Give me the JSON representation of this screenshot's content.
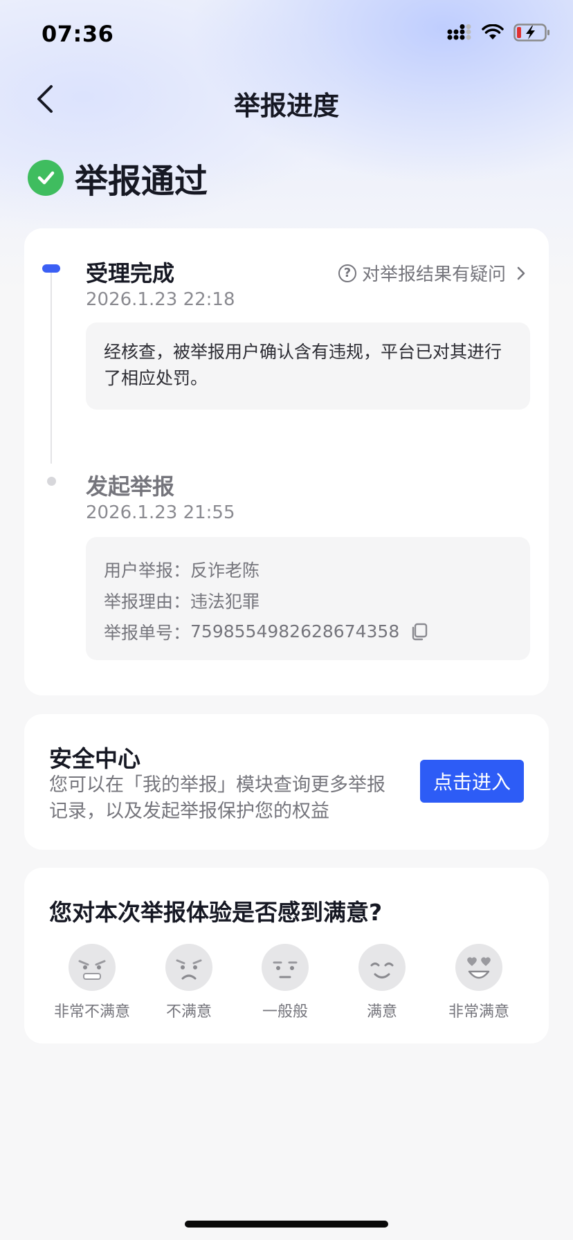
{
  "status_bar": {
    "time": "07:36",
    "icons": [
      "cellular-signal-icon",
      "wifi-icon",
      "battery-charging-icon"
    ]
  },
  "nav": {
    "title": "举报进度",
    "back_icon": "chevron-left-icon"
  },
  "result": {
    "icon": "check-circle-icon",
    "status": "举报通过",
    "color": "#3fbd5f"
  },
  "timeline": {
    "doubt_link": "对举报结果有疑问",
    "steps": [
      {
        "title": "受理完成",
        "time": "2026.1.23 22:18",
        "content": "经核查，被举报用户确认含有违规，平台已对其进行了相应处罚。"
      },
      {
        "title": "发起举报",
        "time": "2026.1.23 21:55",
        "details": [
          {
            "label": "用户举报：",
            "value": "反诈老陈"
          },
          {
            "label": "举报理由：",
            "value": "违法犯罪"
          },
          {
            "label": "举报单号：",
            "value": "7598554982628674358"
          }
        ]
      }
    ]
  },
  "security_center": {
    "title": "安全中心",
    "description": "您可以在「我的举报」模块查询更多举报记录，以及发起举报保护您的权益",
    "button": "点击进入",
    "accent": "#2d5cf6"
  },
  "satisfaction": {
    "question": "您对本次举报体验是否感到满意?",
    "options": [
      {
        "label": "非常不满意",
        "icon": "very-angry-face-icon"
      },
      {
        "label": "不满意",
        "icon": "frown-face-icon"
      },
      {
        "label": "一般般",
        "icon": "neutral-face-icon"
      },
      {
        "label": "满意",
        "icon": "smile-face-icon"
      },
      {
        "label": "非常满意",
        "icon": "heart-eyes-face-icon"
      }
    ]
  }
}
